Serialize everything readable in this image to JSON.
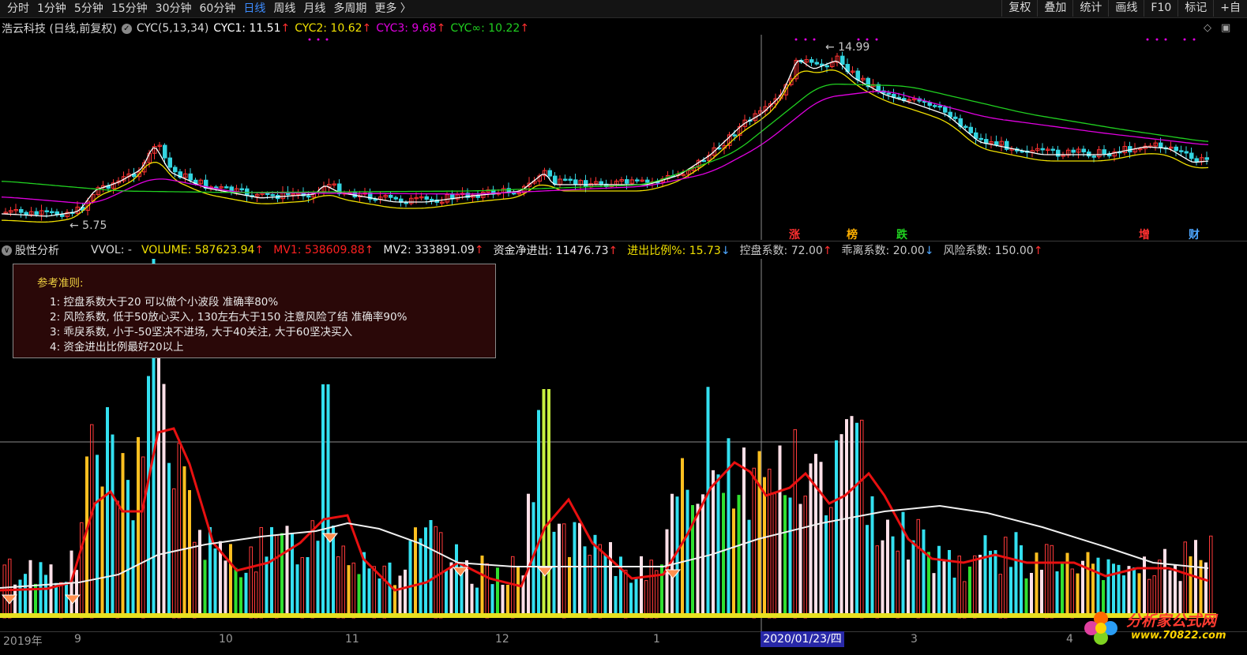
{
  "toolbar": {
    "tabs": [
      "分时",
      "1分钟",
      "5分钟",
      "15分钟",
      "30分钟",
      "60分钟",
      "日线",
      "周线",
      "月线",
      "多周期",
      "更多 〉"
    ],
    "active_tab": "日线",
    "right_tools": [
      "复权",
      "叠加",
      "统计",
      "画线",
      "F10",
      "标记",
      "+自"
    ]
  },
  "main_chart": {
    "stock_title": "浩云科技 (日线,前复权)",
    "indicator_name": "CYC(5,13,34)",
    "cyc1": "CYC1: 11.51",
    "cyc2": "CYC2: 10.62",
    "cyc3": "CYC3: 9.68",
    "cycinf": "CYC∞: 10.22",
    "arrow_up": "↑",
    "high_label": "14.99",
    "low_label": "5.75",
    "event_marks": [
      "涨",
      "榜",
      "跌",
      "增",
      "财"
    ],
    "colors": {
      "cyc1": "#ffffff",
      "cyc2": "#f0e000",
      "cyc3": "#e000e0",
      "cycinf": "#20d020"
    }
  },
  "sub_chart": {
    "panel_name": "股性分析",
    "vvol": "VVOL: -",
    "volume": "VOLUME: 587623.94",
    "mv1": "MV1: 538609.88",
    "mv2": "MV2: 333891.09",
    "fund_net": "资金净进出: 11476.73",
    "fund_ratio": "进出比例%: 15.73",
    "control": "控盘系数: 72.00",
    "deviation": "乖离系数: 20.00",
    "risk": "风险系数: 150.00",
    "arrow_up": "↑",
    "arrow_down": "↓"
  },
  "note": {
    "heading": "参考准则:",
    "lines": [
      "1:  控盘系数大于20 可以做个小波段  准确率80%",
      "2:  风险系数, 低于50放心买入, 130左右大于150 注意风险了结  准确率90%",
      "3:  乖戾系数,   小于-50坚决不进场, 大于40关注, 大于60坚决买入",
      "4:  资金进出比例最好20以上"
    ]
  },
  "x_axis": {
    "labels": [
      "2019年",
      "9",
      "10",
      "11",
      "12",
      "1",
      "3",
      "4"
    ],
    "cursor_date": "2020/01/23/四"
  },
  "watermark": {
    "name": "分析家公式网",
    "url": "www.70822.com"
  }
}
